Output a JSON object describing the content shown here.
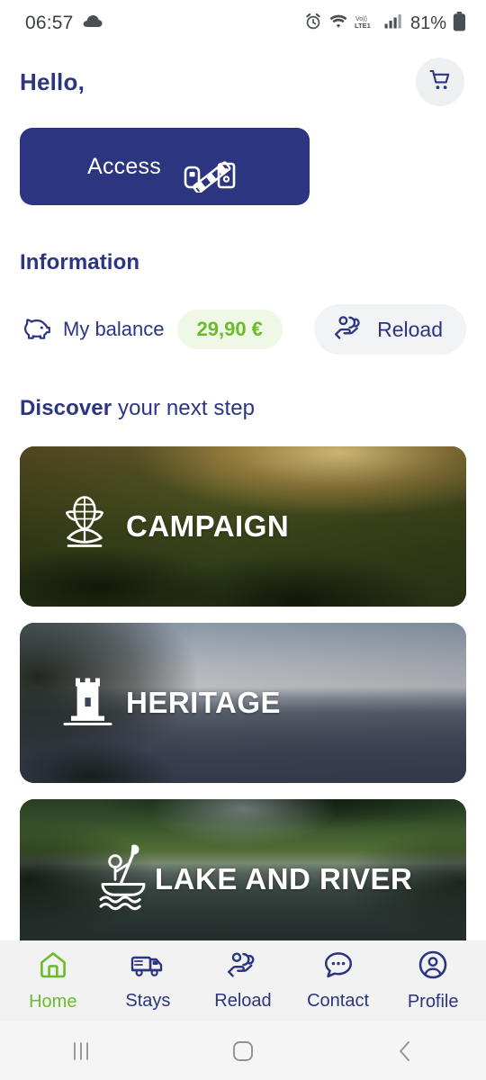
{
  "status_bar": {
    "time": "06:57",
    "battery_percent": "81%",
    "icons": [
      "cloud-icon",
      "alarm-icon",
      "wifi-icon",
      "volte-icon",
      "signal-icon",
      "battery-icon"
    ],
    "network_label": "Vo)) LTE1",
    "text_color": "#3c3f43"
  },
  "header": {
    "greeting": "Hello,",
    "cart_icon": "shopping-cart-icon"
  },
  "access": {
    "label": "Access",
    "icon": "barrier-gate-icon",
    "background": "#2b3580",
    "text_color": "#ffffff"
  },
  "information": {
    "title": "Information",
    "balance_icon": "piggy-bank-icon",
    "balance_label": "My balance",
    "balance_value": "29,90 €",
    "balance_value_color": "#6cbb2b",
    "balance_pill_background": "#eff7e6",
    "reload_label": "Reload",
    "reload_icon": "hand-coins-icon",
    "reload_background": "#f2f3f5"
  },
  "discover": {
    "title_bold": "Discover",
    "title_rest": " your next step",
    "cards": [
      {
        "title": "CAMPAIGN",
        "icon": "corn-cob-icon",
        "scene": "aerial-countryside-sunset"
      },
      {
        "title": "HERITAGE",
        "icon": "castle-tower-icon",
        "scene": "chateau-over-river"
      },
      {
        "title": "LAKE AND RIVER",
        "icon": "kayak-paddler-icon",
        "scene": "green-river-forest"
      }
    ]
  },
  "bottom_nav": {
    "active_index": 0,
    "active_color": "#6cbb2b",
    "inactive_color": "#2b3580",
    "items": [
      {
        "label": "Home",
        "icon": "home-icon"
      },
      {
        "label": "Stays",
        "icon": "camper-van-icon"
      },
      {
        "label": "Reload",
        "icon": "hand-coins-icon"
      },
      {
        "label": "Contact",
        "icon": "chat-bubble-icon"
      },
      {
        "label": "Profile",
        "icon": "user-circle-icon"
      }
    ]
  },
  "android_nav": {
    "keys": [
      "recents-key",
      "home-key",
      "back-key"
    ]
  }
}
